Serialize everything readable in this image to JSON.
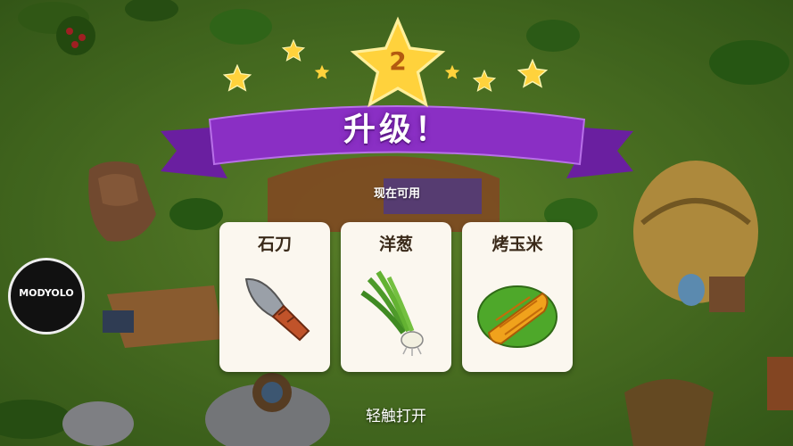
{
  "level_up": {
    "title": "升级！",
    "level": "2",
    "subtitle": "现在可用",
    "tap_hint": "轻触打开"
  },
  "unlocks": [
    {
      "label": "石刀",
      "icon": "stone-knife-icon"
    },
    {
      "label": "洋葱",
      "icon": "onion-icon"
    },
    {
      "label": "烤玉米",
      "icon": "roasted-corn-icon"
    }
  ],
  "watermark": {
    "text": "MODYOLO"
  },
  "colors": {
    "ribbon": "#8a2fc4",
    "star": "#ffd23c",
    "card_bg": "#fbf7ef",
    "grass": "#4d7a25"
  }
}
